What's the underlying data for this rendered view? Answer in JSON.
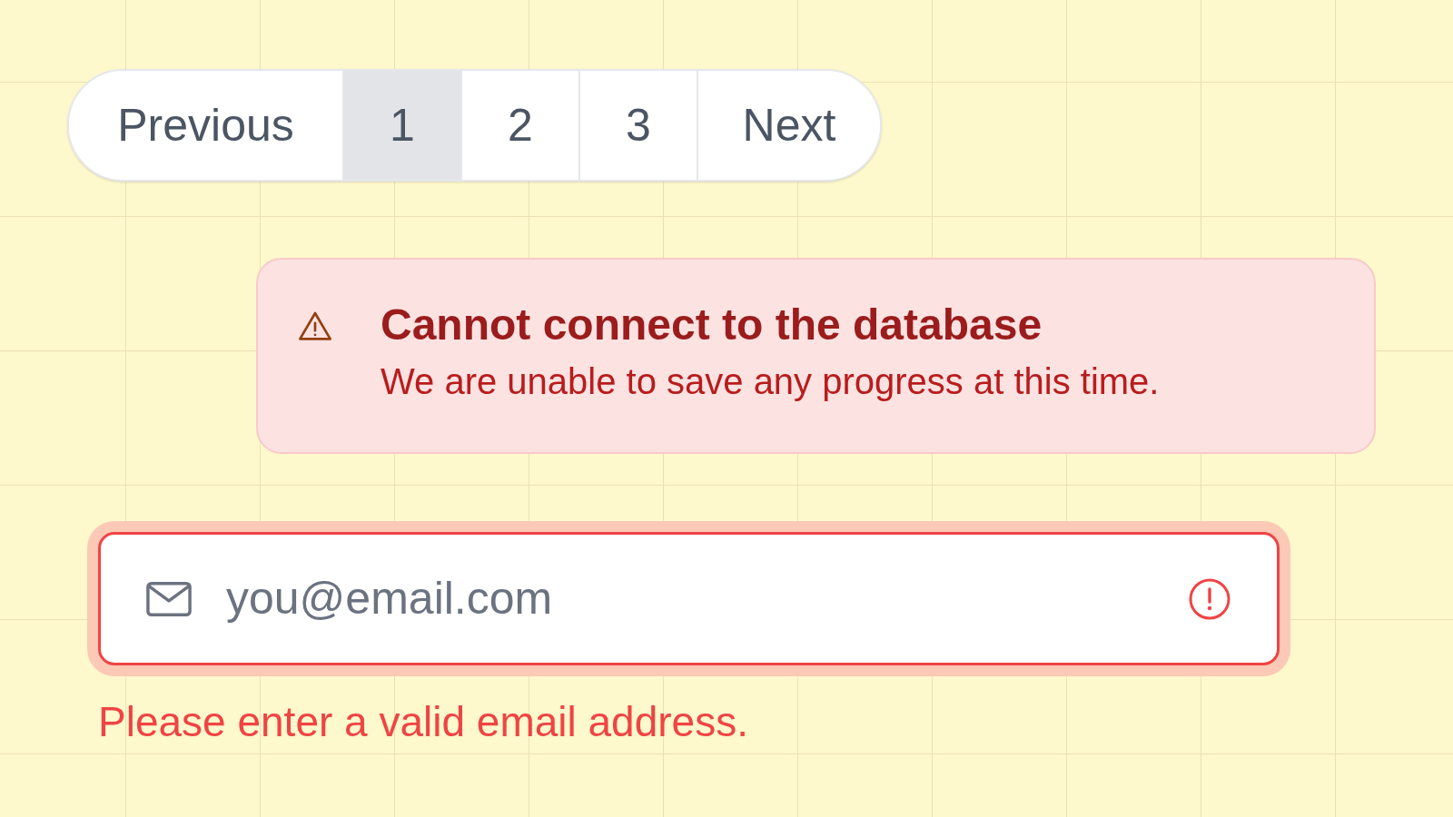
{
  "pagination": {
    "previous": "Previous",
    "next": "Next",
    "pages": [
      {
        "label": "1",
        "selected": true
      },
      {
        "label": "2",
        "selected": false
      },
      {
        "label": "3",
        "selected": false
      }
    ]
  },
  "alert": {
    "kind": "error",
    "title": "Cannot connect to the database",
    "message": "We are unable to save any progress at this time."
  },
  "email_field": {
    "placeholder": "you@email.com",
    "invalid": true,
    "error": "Please enter a valid email address."
  }
}
